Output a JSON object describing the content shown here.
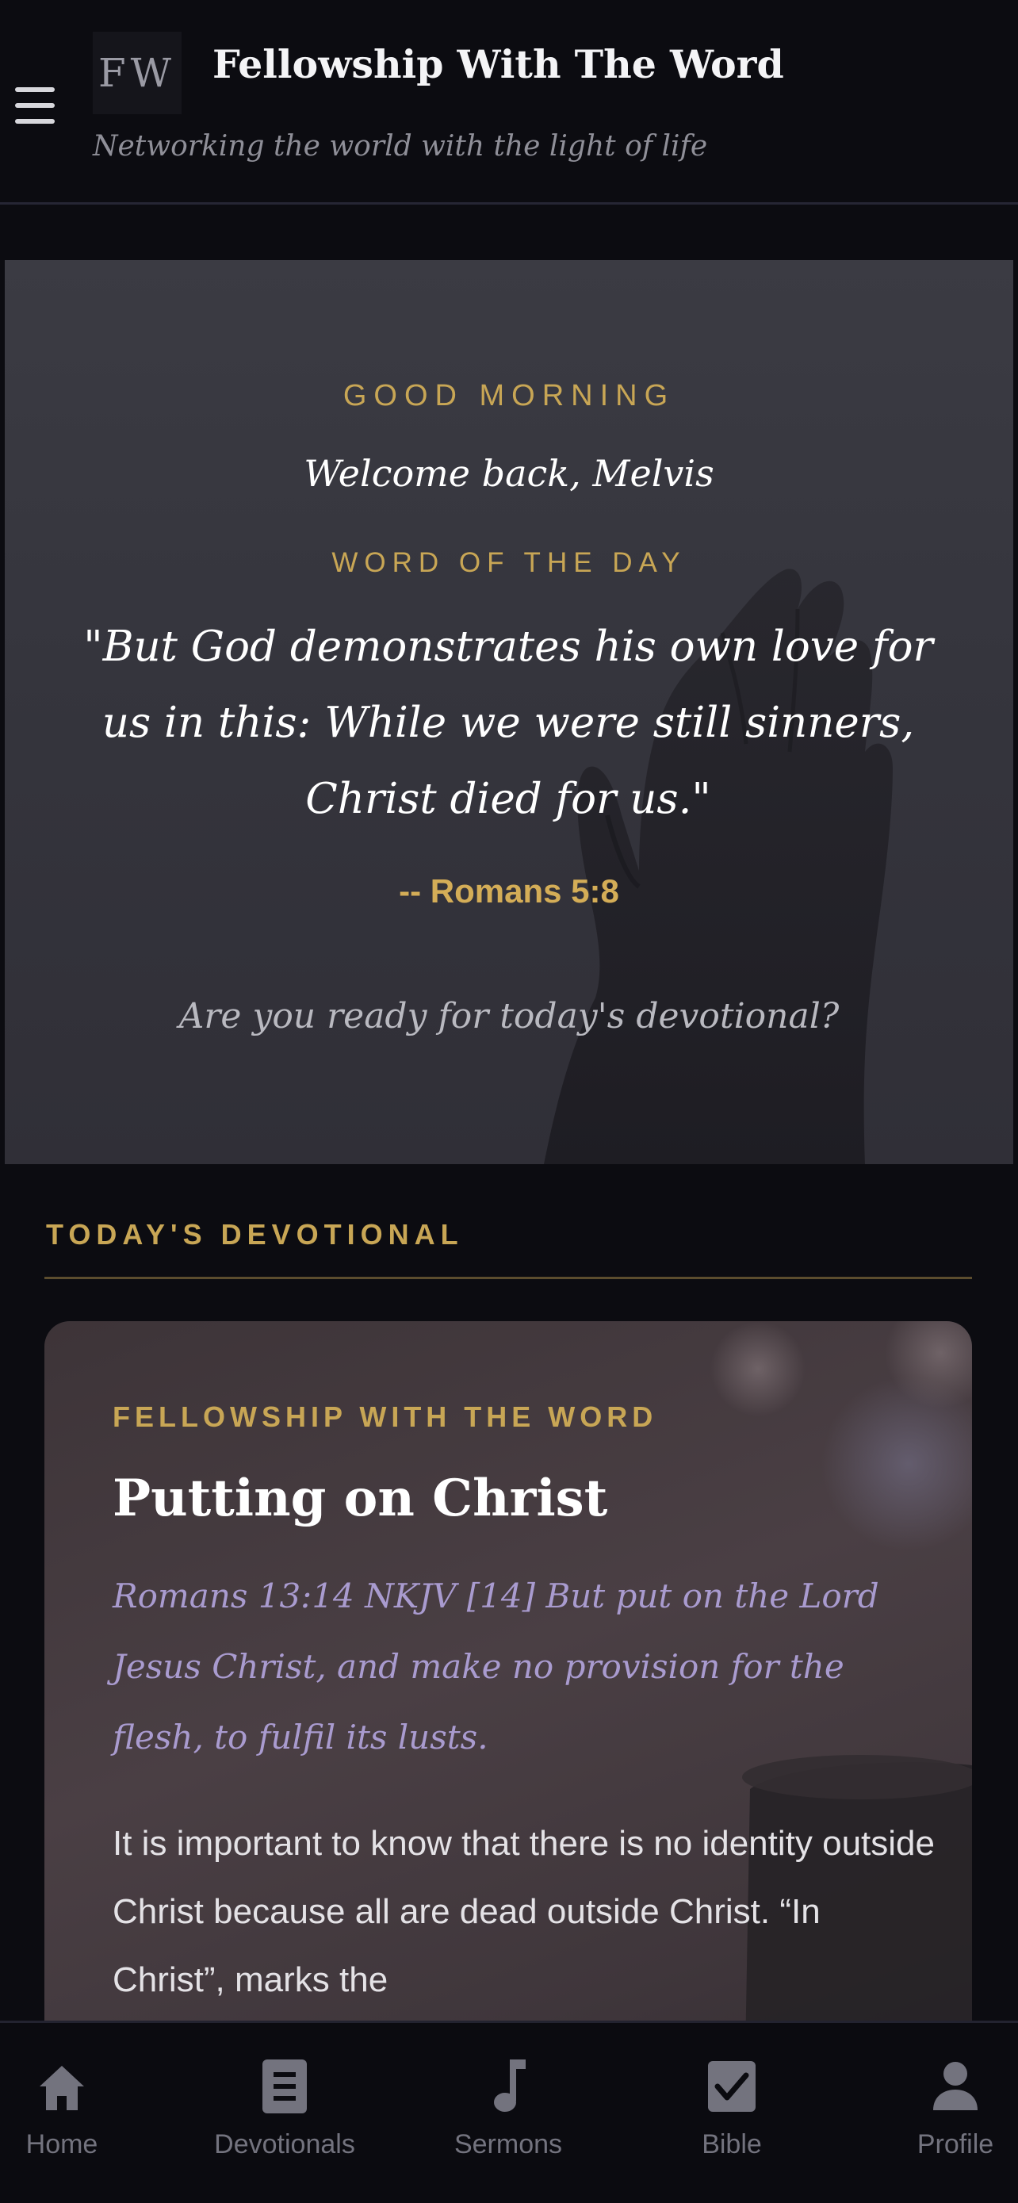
{
  "header": {
    "logo_text": "FW",
    "title": "Fellowship With The Word",
    "tagline": "Networking the world with the light of life",
    "menu_icon": "hamburger-menu-icon"
  },
  "hero": {
    "greeting": "GOOD MORNING",
    "welcome": "Welcome back, Melvis",
    "word_of_day_label": "WORD OF THE DAY",
    "verse": "\"But God demonstrates his own love for us in this: While we were still sinners, Christ died for us.\"",
    "verse_reference": "-- Romans 5:8",
    "prompt": "Are you ready for today's devotional?",
    "background_image": "raised-hand-photo"
  },
  "devotional_section": {
    "title": "TODAY'S DEVOTIONAL",
    "card": {
      "kicker": "FELLOWSHIP WITH THE WORD",
      "title": "Putting on Christ",
      "scripture": "Romans 13:14 NKJV [14] But put on the Lord Jesus Christ, and make no provision for the flesh, to fulfil its lusts.",
      "body": "It is important to know that there is no identity outside Christ because all are dead outside Christ. “In Christ”, marks the",
      "background_image": "coffee-mug-photo"
    }
  },
  "bottom_nav": {
    "items": [
      {
        "label": "Home",
        "icon": "home-icon",
        "active": true
      },
      {
        "label": "Devotionals",
        "icon": "book-icon",
        "active": false
      },
      {
        "label": "Sermons",
        "icon": "music-note-icon",
        "active": false
      },
      {
        "label": "Bible",
        "icon": "checkbox-icon",
        "active": false
      },
      {
        "label": "Profile",
        "icon": "person-icon",
        "active": false
      }
    ]
  },
  "colors": {
    "background": "#0c0c11",
    "accent_gold": "#c8a655",
    "scripture_lavender": "#a99bcf",
    "nav_inactive": "#73737e"
  }
}
